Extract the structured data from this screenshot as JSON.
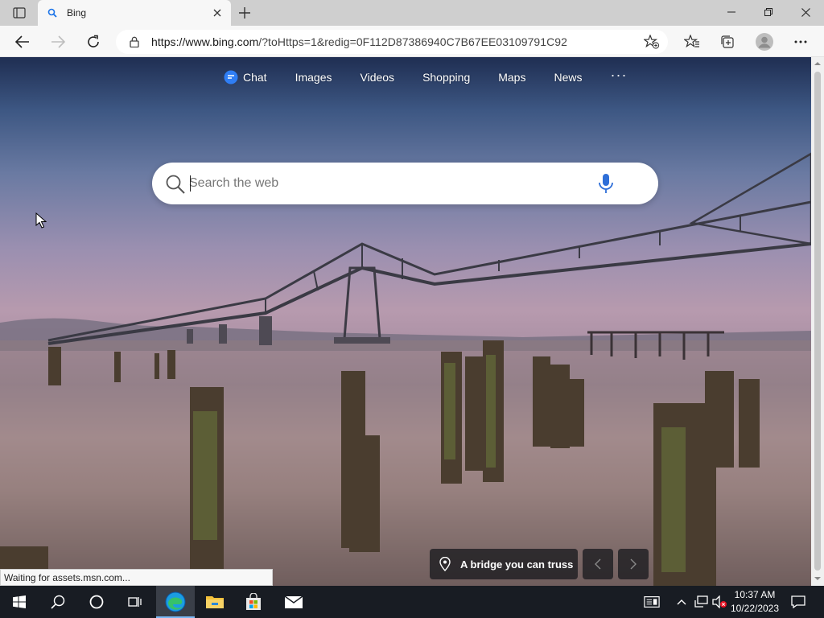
{
  "browser": {
    "tab": {
      "title": "Bing"
    },
    "address": {
      "host": "https://www.bing.com",
      "path": "/?toHttps=1&redig=0F112D87386940C7B67EE03109791C92"
    }
  },
  "nav": {
    "items": [
      {
        "label": "Chat"
      },
      {
        "label": "Images"
      },
      {
        "label": "Videos"
      },
      {
        "label": "Shopping"
      },
      {
        "label": "Maps"
      },
      {
        "label": "News"
      }
    ],
    "more": "···"
  },
  "search": {
    "placeholder": "Search the web"
  },
  "image_caption": {
    "text": "A bridge you can truss"
  },
  "status": {
    "text": "Waiting for assets.msn.com..."
  },
  "taskbar": {
    "time": "10:37 AM",
    "date": "10/22/2023"
  },
  "colors": {
    "accent": "#1a73e8",
    "taskbar": "#181c23"
  }
}
